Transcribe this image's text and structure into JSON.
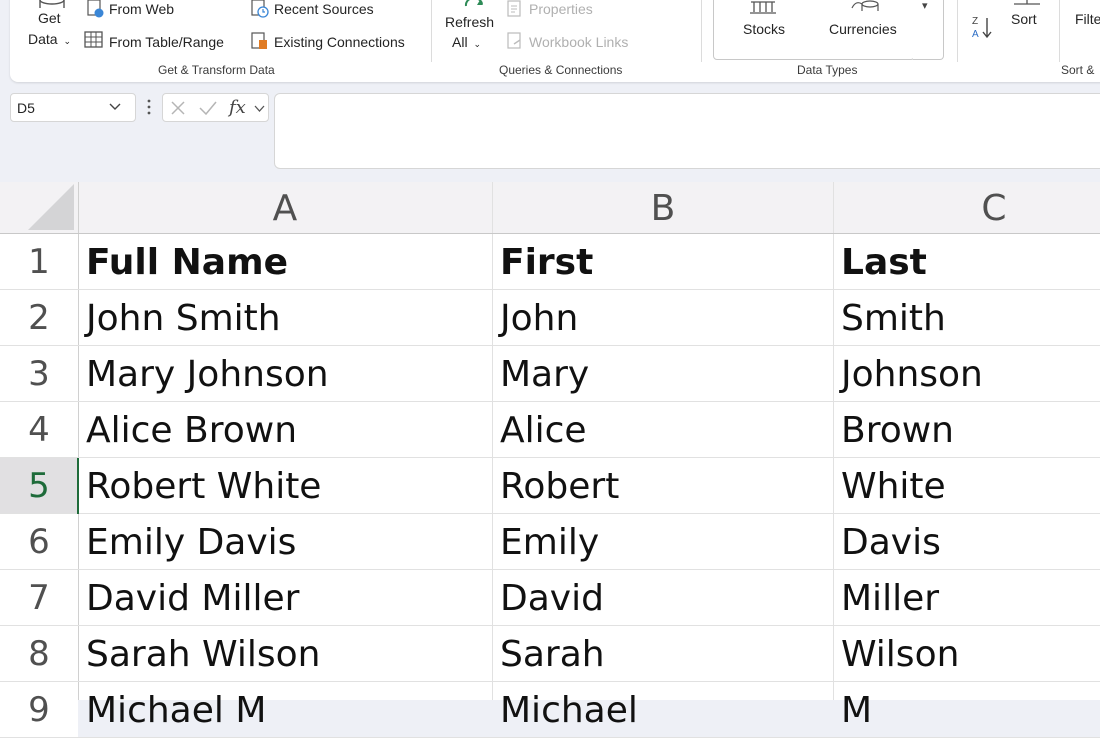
{
  "ribbon": {
    "get_data": {
      "line1": "Get",
      "line2": "Data"
    },
    "from_web": "From Web",
    "from_table": "From Table/Range",
    "recent_sources": "Recent Sources",
    "existing_connections": "Existing Connections",
    "group_get_transform": "Get & Transform Data",
    "refresh_all": {
      "line1": "Refresh",
      "line2": "All"
    },
    "properties": "Properties",
    "workbook_links": "Workbook Links",
    "group_queries": "Queries & Connections",
    "stocks": "Stocks",
    "currencies": "Currencies",
    "group_data_types": "Data Types",
    "sort": "Sort",
    "filter": "Filte",
    "group_sort_filter": "Sort &"
  },
  "formula_bar": {
    "name_box": "D5",
    "fx": "fx",
    "formula": ""
  },
  "grid": {
    "columns": [
      "A",
      "B",
      "C"
    ],
    "rows": [
      {
        "num": "1",
        "cells": [
          "Full Name",
          "First",
          "Last"
        ]
      },
      {
        "num": "2",
        "cells": [
          "John Smith",
          "John",
          "Smith"
        ]
      },
      {
        "num": "3",
        "cells": [
          "Mary Johnson",
          "Mary",
          "Johnson"
        ]
      },
      {
        "num": "4",
        "cells": [
          "Alice Brown",
          "Alice",
          "Brown"
        ]
      },
      {
        "num": "5",
        "cells": [
          "Robert White",
          "Robert",
          "White"
        ]
      },
      {
        "num": "6",
        "cells": [
          "Emily Davis",
          "Emily",
          "Davis"
        ]
      },
      {
        "num": "7",
        "cells": [
          "David Miller",
          "David",
          "Miller"
        ]
      },
      {
        "num": "8",
        "cells": [
          "Sarah Wilson",
          "Sarah",
          "Wilson"
        ]
      },
      {
        "num": "9",
        "cells": [
          "Michael M",
          "Michael",
          "M"
        ]
      }
    ],
    "selected_row": "5"
  },
  "colors": {
    "accent_green": "#1e6b3a",
    "grid_line": "#e1e1e1"
  }
}
